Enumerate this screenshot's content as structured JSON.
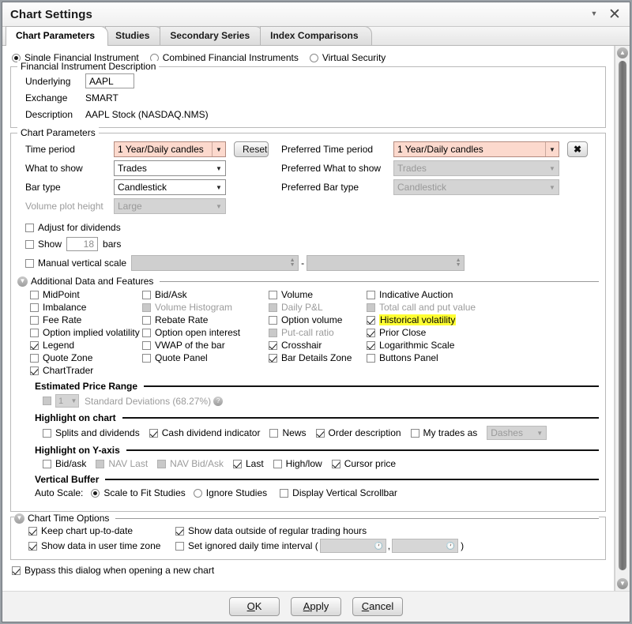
{
  "window": {
    "title": "Chart Settings",
    "minimize_icon": "chevron-down-icon",
    "close_icon": "close-icon"
  },
  "tabs": [
    {
      "label": "Chart Parameters",
      "active": true
    },
    {
      "label": "Studies",
      "active": false
    },
    {
      "label": "Secondary Series",
      "active": false
    },
    {
      "label": "Index Comparisons",
      "active": false
    }
  ],
  "instrument_mode": {
    "options": [
      {
        "label": "Single Financial Instrument",
        "selected": true,
        "disabled": false
      },
      {
        "label": "Combined Financial Instruments",
        "selected": false,
        "disabled": false
      },
      {
        "label": "Virtual Security",
        "selected": false,
        "disabled": false
      }
    ]
  },
  "financial_instrument_description": {
    "title": "Financial Instrument Description",
    "underlying_label": "Underlying",
    "underlying_value": "AAPL",
    "exchange_label": "Exchange",
    "exchange_value": "SMART",
    "description_label": "Description",
    "description_value": "AAPL Stock (NASDAQ.NMS)"
  },
  "chart_parameters": {
    "title": "Chart Parameters",
    "time_period_label": "Time period",
    "time_period_value": "1 Year/Daily candles",
    "reset_button": "Reset",
    "what_to_show_label": "What to show",
    "what_to_show_value": "Trades",
    "bar_type_label": "Bar type",
    "bar_type_value": "Candlestick",
    "volume_plot_height_label": "Volume plot height",
    "volume_plot_height_value": "Large",
    "preferred_time_period_label": "Preferred Time period",
    "preferred_time_period_value": "1 Year/Daily candles",
    "clear_preferred_button": "✖",
    "preferred_what_to_show_label": "Preferred What to show",
    "preferred_what_to_show_value": "Trades",
    "preferred_bar_type_label": "Preferred Bar type",
    "preferred_bar_type_value": "Candlestick",
    "adjust_for_dividends": {
      "label": "Adjust for dividends",
      "checked": false
    },
    "show_bars": {
      "label": "Show",
      "value": "18",
      "suffix": "bars",
      "checked": false
    },
    "manual_vertical_scale": {
      "label": "Manual vertical scale",
      "checked": false,
      "separator": "-"
    }
  },
  "additional_data": {
    "title": "Additional Data and Features",
    "items": [
      {
        "label": "MidPoint",
        "checked": false,
        "disabled": false,
        "highlight": false
      },
      {
        "label": "Bid/Ask",
        "checked": false,
        "disabled": false,
        "highlight": false
      },
      {
        "label": "Volume",
        "checked": false,
        "disabled": false,
        "highlight": false
      },
      {
        "label": "Indicative Auction",
        "checked": false,
        "disabled": false,
        "highlight": false
      },
      {
        "label": "Imbalance",
        "checked": false,
        "disabled": false,
        "highlight": false
      },
      {
        "label": "Volume Histogram",
        "checked": false,
        "disabled": true,
        "highlight": false
      },
      {
        "label": "Daily P&L",
        "checked": false,
        "disabled": true,
        "highlight": false
      },
      {
        "label": "Total call and put value",
        "checked": false,
        "disabled": true,
        "highlight": false
      },
      {
        "label": "Fee Rate",
        "checked": false,
        "disabled": false,
        "highlight": false
      },
      {
        "label": "Rebate Rate",
        "checked": false,
        "disabled": false,
        "highlight": false
      },
      {
        "label": "Option volume",
        "checked": false,
        "disabled": false,
        "highlight": false
      },
      {
        "label": "Historical volatility",
        "checked": true,
        "disabled": false,
        "highlight": true
      },
      {
        "label": "Option implied volatility",
        "checked": false,
        "disabled": false,
        "highlight": false
      },
      {
        "label": "Option open interest",
        "checked": false,
        "disabled": false,
        "highlight": false
      },
      {
        "label": "Put-call ratio",
        "checked": false,
        "disabled": true,
        "highlight": false
      },
      {
        "label": "Prior Close",
        "checked": true,
        "disabled": false,
        "highlight": false
      },
      {
        "label": "Legend",
        "checked": true,
        "disabled": false,
        "highlight": false
      },
      {
        "label": "VWAP of the bar",
        "checked": false,
        "disabled": false,
        "highlight": false
      },
      {
        "label": "Crosshair",
        "checked": true,
        "disabled": false,
        "highlight": false
      },
      {
        "label": "Logarithmic Scale",
        "checked": true,
        "disabled": false,
        "highlight": false
      },
      {
        "label": "Quote Zone",
        "checked": false,
        "disabled": false,
        "highlight": false
      },
      {
        "label": "Quote Panel",
        "checked": false,
        "disabled": false,
        "highlight": false
      },
      {
        "label": "Bar Details Zone",
        "checked": true,
        "disabled": false,
        "highlight": false
      },
      {
        "label": "Buttons Panel",
        "checked": false,
        "disabled": false,
        "highlight": false
      },
      {
        "label": "ChartTrader",
        "checked": true,
        "disabled": false,
        "highlight": false
      }
    ]
  },
  "estimated_price_range": {
    "title": "Estimated Price Range",
    "checked": false,
    "deviations_value": "1",
    "label": "Standard Deviations (68.27%)",
    "help_icon": "help-icon"
  },
  "highlight_on_chart": {
    "title": "Highlight on chart",
    "items": [
      {
        "label": "Splits and dividends",
        "checked": false,
        "disabled": false
      },
      {
        "label": "Cash dividend indicator",
        "checked": true,
        "disabled": false
      },
      {
        "label": "News",
        "checked": false,
        "disabled": false
      },
      {
        "label": "Order description",
        "checked": true,
        "disabled": false
      },
      {
        "label": "My trades as",
        "checked": false,
        "disabled": false
      }
    ],
    "my_trades_style": "Dashes"
  },
  "highlight_on_yaxis": {
    "title": "Highlight on Y-axis",
    "items": [
      {
        "label": "Bid/ask",
        "checked": false,
        "disabled": false
      },
      {
        "label": "NAV Last",
        "checked": false,
        "disabled": true
      },
      {
        "label": "NAV Bid/Ask",
        "checked": false,
        "disabled": true
      },
      {
        "label": "Last",
        "checked": true,
        "disabled": false
      },
      {
        "label": "High/low",
        "checked": false,
        "disabled": false
      },
      {
        "label": "Cursor price",
        "checked": true,
        "disabled": false
      }
    ]
  },
  "vertical_buffer": {
    "title": "Vertical Buffer",
    "auto_scale_label": "Auto Scale:",
    "options": [
      {
        "label": "Scale to Fit Studies",
        "selected": true
      },
      {
        "label": "Ignore Studies",
        "selected": false
      }
    ],
    "display_vertical_scrollbar": {
      "label": "Display Vertical Scrollbar",
      "checked": false
    }
  },
  "chart_time_options": {
    "title": "Chart Time Options",
    "keep_chart_up_to_date": {
      "label": "Keep chart up-to-date",
      "checked": true
    },
    "show_data_outside": {
      "label": "Show data outside of regular trading hours",
      "checked": true
    },
    "show_user_time_zone": {
      "label": "Show data in user time zone",
      "checked": true
    },
    "set_ignored_interval": {
      "label": "Set ignored daily time interval (",
      "checked": false,
      "sep": ",",
      "close": ")",
      "from": "",
      "to": ""
    }
  },
  "bypass": {
    "label": "Bypass this dialog when opening a new chart",
    "checked": true
  },
  "footer": {
    "ok": "OK",
    "apply": "Apply",
    "cancel": "Cancel"
  },
  "colors": {
    "accent_pink": "#fcd9cd",
    "highlight_yellow": "#ffff33",
    "disabled_gray": "#9b9b9b"
  }
}
